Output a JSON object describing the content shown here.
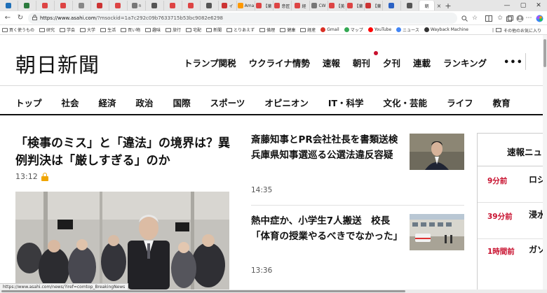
{
  "browser": {
    "tabs": [
      {
        "label": "",
        "color": "#1f6fb8"
      },
      {
        "label": "",
        "color": "#2b7a3d"
      },
      {
        "label": "",
        "color": "#d44"
      },
      {
        "label": "",
        "color": "#d44"
      },
      {
        "label": "",
        "color": "#888"
      },
      {
        "label": "",
        "color": "#c33"
      },
      {
        "label": "",
        "color": "#d44"
      },
      {
        "label": "n",
        "color": "#777"
      },
      {
        "label": "",
        "color": "#555"
      },
      {
        "label": "",
        "color": "#d44"
      },
      {
        "label": "",
        "color": "#d44"
      },
      {
        "label": "",
        "color": "#555"
      },
      {
        "label": "イ",
        "color": "#c33"
      },
      {
        "label": "Ama",
        "color": "#f90"
      },
      {
        "label": "【薬",
        "color": "#d44"
      },
      {
        "label": "意匠",
        "color": "#d44"
      },
      {
        "label": "経",
        "color": "#d44"
      },
      {
        "label": "CW",
        "color": "#777"
      },
      {
        "label": "【美",
        "color": "#d44"
      },
      {
        "label": "【薬",
        "color": "#d44"
      },
      {
        "label": "【薬",
        "color": "#c33"
      },
      {
        "label": "",
        "color": "#2b62c4"
      },
      {
        "label": "",
        "color": "#555"
      }
    ],
    "active_tab": {
      "label": "朝"
    },
    "close_glyph": "×",
    "new_tab_glyph": "+",
    "window_controls": {
      "minimize": "—",
      "maximize": "▢",
      "close": "✕"
    },
    "nav": {
      "back": "←",
      "reload": "↻"
    },
    "url": {
      "host": "https://www.asahi.com",
      "path": "/?msockid=1a7c292c09b7633715b53bc9082e6298"
    },
    "bookmarks": [
      {
        "label": "買く使うもの",
        "kind": "folder"
      },
      {
        "label": "研究",
        "kind": "folder"
      },
      {
        "label": "学会",
        "kind": "folder"
      },
      {
        "label": "大学",
        "kind": "folder"
      },
      {
        "label": "生活",
        "kind": "folder"
      },
      {
        "label": "買い物",
        "kind": "folder"
      },
      {
        "label": "趣味",
        "kind": "folder"
      },
      {
        "label": "旅行",
        "kind": "folder"
      },
      {
        "label": "宅配",
        "kind": "folder"
      },
      {
        "label": "新聞",
        "kind": "folder"
      },
      {
        "label": "とりあえず",
        "kind": "folder"
      },
      {
        "label": "倫理",
        "kind": "folder"
      },
      {
        "label": "健康",
        "kind": "folder"
      },
      {
        "label": "経産",
        "kind": "folder"
      },
      {
        "label": "Gmail",
        "kind": "site",
        "color": "#d93025"
      },
      {
        "label": "マップ",
        "kind": "site",
        "color": "#34a853"
      },
      {
        "label": "YouTube",
        "kind": "site",
        "color": "#ff0000"
      },
      {
        "label": "ニュース",
        "kind": "site",
        "color": "#4285f4"
      },
      {
        "label": "Wayback Machine",
        "kind": "site",
        "color": "#333333"
      }
    ],
    "bookmarks_more": "その他のお気に入り",
    "status_url": "https://www.asahi.com/news/?iref=comtop_BreakingNews"
  },
  "site": {
    "logo": "朝日新聞",
    "top_nav": [
      "トランプ関税",
      "ウクライナ情勢",
      "速報",
      "朝刊",
      "夕刊",
      "連載",
      "ランキング"
    ],
    "more": "•••",
    "category_nav": [
      "トップ",
      "社会",
      "経済",
      "政治",
      "国際",
      "スポーツ",
      "オピニオン",
      "IT・科学",
      "文化・芸能",
      "ライフ",
      "教育"
    ]
  },
  "lead": {
    "title": "「検事のミス」と「違法」の境界は？異例判決は「厳しすぎる」のか",
    "time": "13:12"
  },
  "stories": [
    {
      "title": "斎藤知事とPR会社社長を書類送検　兵庫県知事選巡る公選法違反容疑",
      "time": "14:35"
    },
    {
      "title": "熱中症か、小学生7人搬送　校長「体育の授業やるべきでなかった」",
      "time": "13:36"
    }
  ],
  "flash": {
    "heading": "速報ニュース",
    "items": [
      {
        "time": "9分前",
        "text": "ロシめ通"
      },
      {
        "time": "39分前",
        "text": "浸水任院"
      },
      {
        "time": "1時間前",
        "text": "ガソ採決"
      }
    ]
  },
  "colors": {
    "accent_red": "#c8102e",
    "premium_lock": "#f0a500"
  }
}
